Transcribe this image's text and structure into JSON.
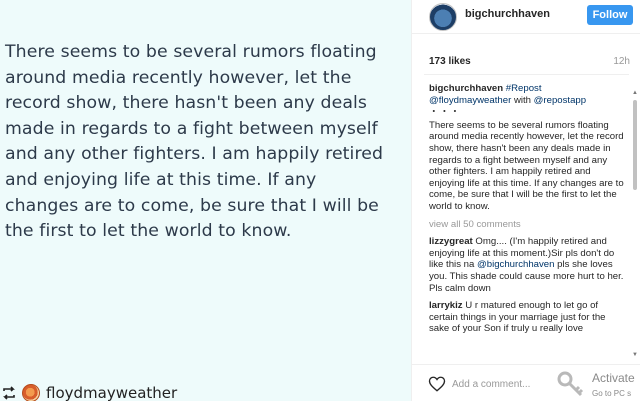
{
  "post": {
    "image_text_lines": [
      "There seems to be several rumors floating",
      "around media recently however, let the",
      "record show, there hasn't been any deals",
      "made in regards to a fight between myself",
      "and any other fighters. I am happily retired",
      "and enjoying life at this time. If any",
      "changes are to come, be sure that I will be",
      "the first to let the world to know."
    ],
    "regram_username": "floydmayweather"
  },
  "header": {
    "username": "bigchurchhaven",
    "follow_label": "Follow"
  },
  "stats": {
    "likes": "173 likes",
    "time_ago": "12h"
  },
  "caption": {
    "username": "bigchurchhaven",
    "repost_tag": "#Repost",
    "mention": "@floydmayweather",
    "with_text": "with",
    "app_mention": "@repostapp",
    "dots": "・・・",
    "body": "There seems to be several rumors floating around media recently however, let the record show, there hasn't been any deals made in regards to a fight between myself and any other fighters. I am happily retired and enjoying life at this time. If any changes are to come, be sure that I will be the first to let the world to know."
  },
  "view_all": "view all 50 comments",
  "comments": [
    {
      "user": "lizzygreat",
      "text_before": "Omg.... (I'm happily retired and enjoying life at this moment.)Sir pls don't do like this na",
      "mention": "@bigchurchhaven",
      "text_after": "pls she loves you. This shade could cause more hurt to her. Pls calm down"
    },
    {
      "user": "larrykiz",
      "text": "U r matured enough to let go of certain things in your marriage just for the sake of your Son if truly u really love"
    }
  ],
  "add_comment": {
    "placeholder": "Add a comment..."
  },
  "watermark": {
    "title": "Activate",
    "subtitle": "Go to PC s"
  },
  "colors": {
    "follow_button": "#3897f0",
    "link_blue": "#003569",
    "image_background": "#eefbfb"
  }
}
